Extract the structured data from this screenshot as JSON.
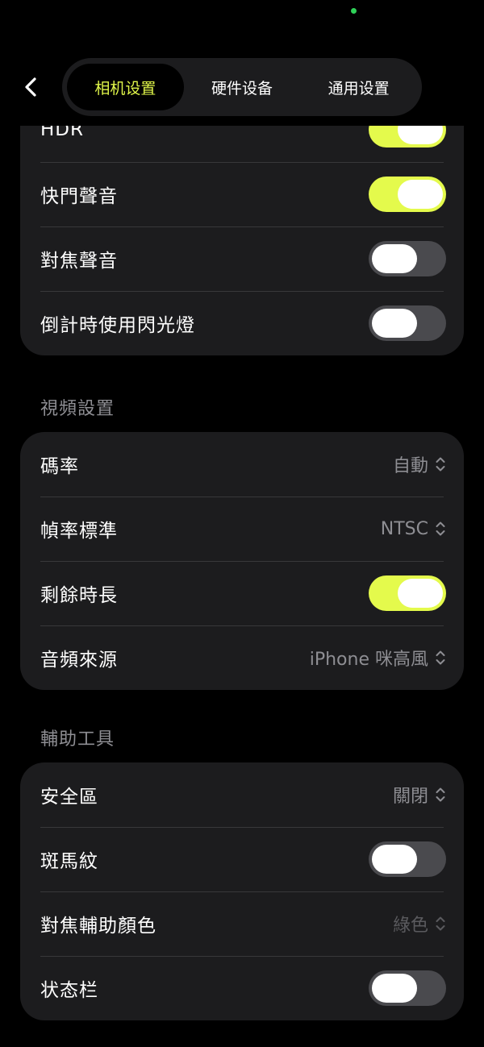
{
  "colors": {
    "accent": "#e1f74a",
    "toggle_on": "#e4fa4c",
    "toggle_off": "#4a4a4e",
    "card": "#1c1c1e",
    "status_dot": "#2fd158"
  },
  "header": {
    "back_icon": "chevron-left-icon",
    "tabs": [
      {
        "label": "相机设置",
        "active": true
      },
      {
        "label": "硬件设备",
        "active": false
      },
      {
        "label": "通用设置",
        "active": false
      }
    ]
  },
  "camera_card": {
    "rows": [
      {
        "label": "HDR",
        "toggle": true
      },
      {
        "label": "快門聲音",
        "toggle": true
      },
      {
        "label": "對焦聲音",
        "toggle": false
      },
      {
        "label": "倒計時使用閃光燈",
        "toggle": false
      }
    ]
  },
  "video": {
    "header": "視頻設置",
    "rows": [
      {
        "label": "碼率",
        "value": "自動"
      },
      {
        "label": "幀率標準",
        "value": "NTSC"
      },
      {
        "label": "剩餘時長",
        "toggle": true
      },
      {
        "label": "音頻來源",
        "value": "iPhone 咪高風"
      }
    ]
  },
  "assist": {
    "header": "輔助工具",
    "rows": [
      {
        "label": "安全區",
        "value": "關閉"
      },
      {
        "label": "斑馬紋",
        "toggle": false
      },
      {
        "label": "對焦輔助顏色",
        "value": "綠色"
      },
      {
        "label": "状态栏",
        "toggle": false
      }
    ]
  }
}
